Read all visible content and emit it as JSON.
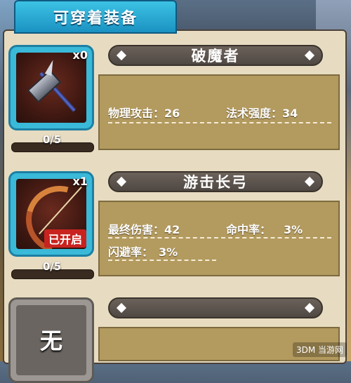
{
  "header": {
    "title": "可穿着装备"
  },
  "items": [
    {
      "name": "破魔者",
      "count": "x0",
      "progress_label": "0/5",
      "progress": 0,
      "icon": "war-hammer-icon",
      "unlocked_label": "",
      "stats": [
        {
          "label": "物理攻击：",
          "value": "26"
        },
        {
          "label": "法术强度：",
          "value": "34"
        }
      ]
    },
    {
      "name": "游击长弓",
      "count": "x1",
      "progress_label": "0/5",
      "progress": 0,
      "icon": "longbow-icon",
      "unlocked_label": "已开启",
      "stats": [
        {
          "label": "最终伤害：",
          "value": "42"
        },
        {
          "label": "命中率：",
          "value": "3%"
        },
        {
          "label": "闪避率：",
          "value": "3%"
        }
      ]
    },
    {
      "name": "",
      "empty_label": "无",
      "icon": "empty-slot"
    }
  ],
  "watermark": "3DM 当游网",
  "colors": {
    "header": "#1b92c2",
    "card_border": "#1d7fa3",
    "stats_bg": "#b39a5e",
    "name_bar": "#4f4842",
    "unlocked_badge": "#c8231f"
  }
}
